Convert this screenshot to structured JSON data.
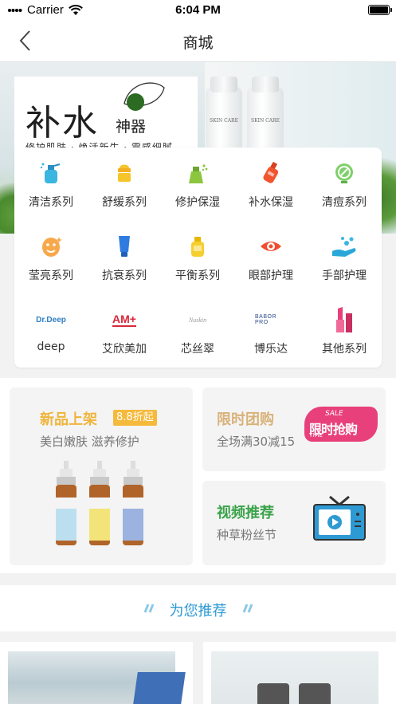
{
  "status": {
    "carrier": "Carrier",
    "time": "6:04 PM"
  },
  "nav": {
    "title": "商城"
  },
  "banner": {
    "big": "补水",
    "small": "神器",
    "sub": "修护肌肤 · 焕活新生 · 震感细腻",
    "bottle_label": "SKIN CARE"
  },
  "categories": [
    {
      "label": "清洁系列",
      "icon": "cleanser-spray-icon"
    },
    {
      "label": "舒缓系列",
      "icon": "cream-jar-icon"
    },
    {
      "label": "修护保湿",
      "icon": "repair-spray-icon"
    },
    {
      "label": "补水保湿",
      "icon": "water-bottle-icon"
    },
    {
      "label": "清痘系列",
      "icon": "acne-circle-icon"
    },
    {
      "label": "莹亮系列",
      "icon": "face-mask-icon"
    },
    {
      "label": "抗衰系列",
      "icon": "tube-icon"
    },
    {
      "label": "平衡系列",
      "icon": "balance-bottle-icon"
    },
    {
      "label": "眼部护理",
      "icon": "eye-icon"
    },
    {
      "label": "手部护理",
      "icon": "hand-bubble-icon"
    },
    {
      "label": "deep",
      "icon": "dr-deep-logo",
      "logo_text": "Dr.Deep"
    },
    {
      "label": "艾欣美加",
      "icon": "am-plus-logo",
      "logo_text": "AM+"
    },
    {
      "label": "芯丝翠",
      "icon": "xinsicui-logo",
      "logo_text": "Nuskin"
    },
    {
      "label": "博乐达",
      "icon": "bolada-logo",
      "logo_text": "BABOR PRO"
    },
    {
      "label": "其他系列",
      "icon": "lipstick-icon"
    }
  ],
  "promo": {
    "new": {
      "title": "新品上架",
      "tag": "8.8折起",
      "sub": "美白嫩肤 滋养修护"
    },
    "group": {
      "title": "限时团购",
      "sub": "全场满30减15",
      "badge_top": "SALE",
      "badge_main": "限时抢购",
      "badge_time": "TIME"
    },
    "video": {
      "title": "视频推荐",
      "sub": "种草粉丝节"
    }
  },
  "recommend": {
    "title": "为您推荐"
  },
  "colors": {
    "accent": "#2e9ad4",
    "gold": "#f0b43a",
    "green": "#3aa34a",
    "pink": "#e8407a"
  }
}
